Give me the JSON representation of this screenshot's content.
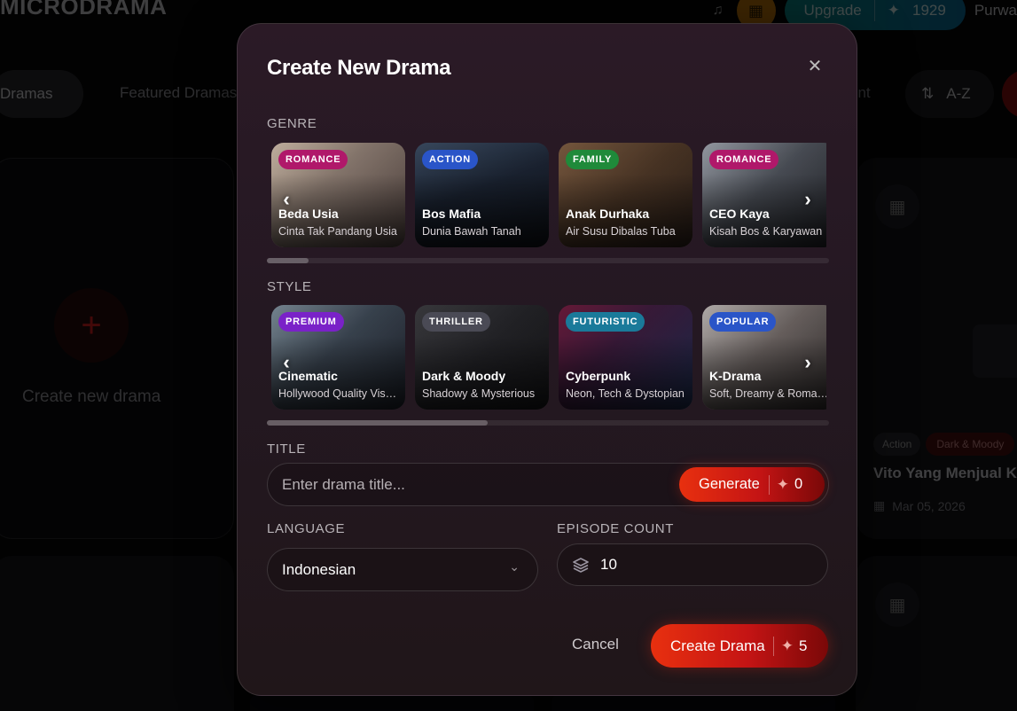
{
  "background": {
    "brand": "MICRODRAMA",
    "upgrade_label": "Upgrade",
    "credits": "1929",
    "user_name": "Purwa",
    "tabs": [
      "Dramas",
      "Featured Dramas",
      "ent"
    ],
    "sort_label": "A-Z",
    "create_card_label": "Create new drama",
    "card": {
      "tags": [
        "Action",
        "Dark & Moody"
      ],
      "title": "Vito Yang Menjual Ke",
      "date": "Mar 05, 2026"
    }
  },
  "modal": {
    "title": "Create New Drama",
    "genre_label": "GENRE",
    "style_label": "STYLE",
    "title_label": "TITLE",
    "language_label": "LANGUAGE",
    "episode_label": "EPISODE COUNT",
    "genres": [
      {
        "badge": "ROMANCE",
        "title": "Beda Usia",
        "subtitle": "Cinta Tak Pandang Usia",
        "badge_color": "#b0186a"
      },
      {
        "badge": "ACTION",
        "title": "Bos Mafia",
        "subtitle": "Dunia Bawah Tanah",
        "badge_color": "#2a55c8"
      },
      {
        "badge": "FAMILY",
        "title": "Anak Durhaka",
        "subtitle": "Air Susu Dibalas Tuba",
        "badge_color": "#1f8a3a"
      },
      {
        "badge": "ROMANCE",
        "title": "CEO Kaya",
        "subtitle": "Kisah Bos & Karyawan",
        "badge_color": "#b0186a"
      }
    ],
    "styles": [
      {
        "badge": "PREMIUM",
        "title": "Cinematic",
        "subtitle": "Hollywood Quality Visuals",
        "badge_color": "#7a22c8"
      },
      {
        "badge": "THRILLER",
        "title": "Dark & Moody",
        "subtitle": "Shadowy & Mysterious",
        "badge_color": "#4a4a55"
      },
      {
        "badge": "FUTURISTIC",
        "title": "Cyberpunk",
        "subtitle": "Neon, Tech & Dystopian",
        "badge_color": "#1a7a9a"
      },
      {
        "badge": "POPULAR",
        "title": "K-Drama",
        "subtitle": "Soft, Dreamy & Romantic",
        "badge_color": "#2a55c8"
      }
    ],
    "title_placeholder": "Enter drama title...",
    "generate_label": "Generate",
    "generate_cost": "0",
    "language_value": "Indonesian",
    "episode_value": "10",
    "cancel_label": "Cancel",
    "create_label": "Create Drama",
    "create_cost": "5"
  }
}
